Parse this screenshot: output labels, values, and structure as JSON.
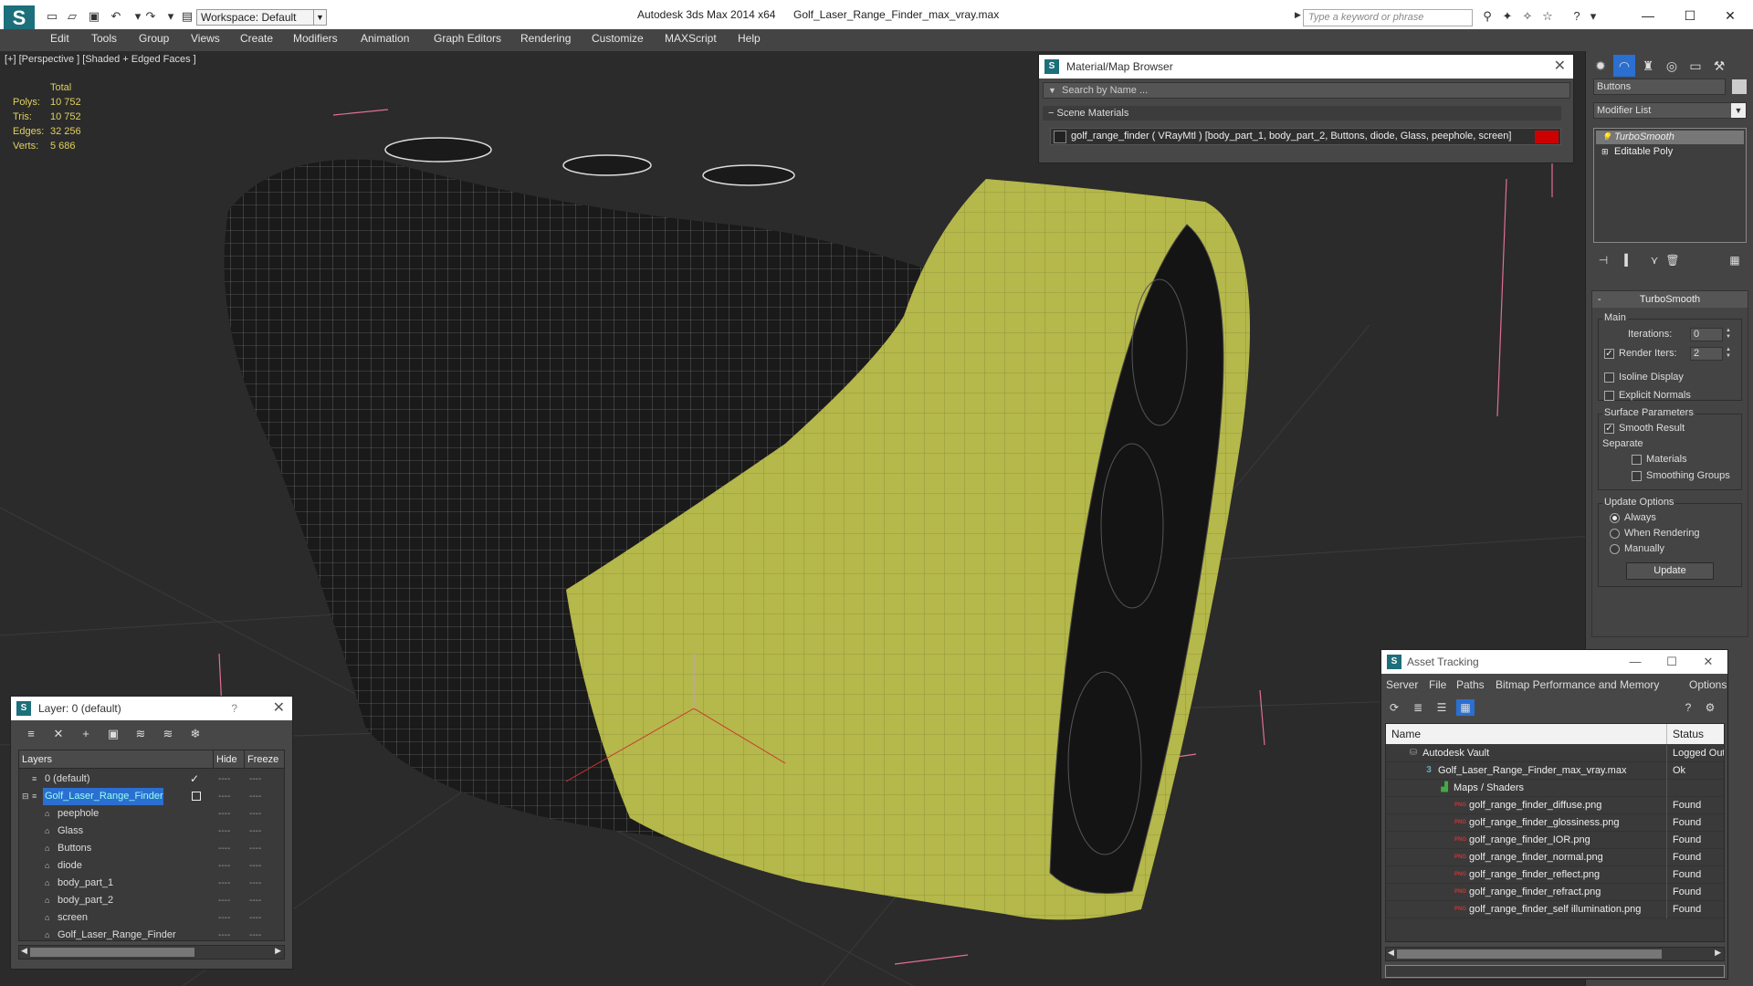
{
  "titlebar": {
    "app_title": "Autodesk 3ds Max  2014 x64",
    "file_title": "Golf_Laser_Range_Finder_max_vray.max",
    "workspace": "Workspace: Default",
    "search_placeholder": "Type a keyword or phrase"
  },
  "menu": [
    "Edit",
    "Tools",
    "Group",
    "Views",
    "Create",
    "Modifiers",
    "Animation",
    "Graph Editors",
    "Rendering",
    "Customize",
    "MAXScript",
    "Help"
  ],
  "viewport": {
    "label": "[+] [Perspective ] [Shaded + Edged Faces ]",
    "stats": {
      "total_label": "Total",
      "rows": [
        {
          "label": "Polys:",
          "value": "10 752"
        },
        {
          "label": "Tris:",
          "value": "10 752"
        },
        {
          "label": "Edges:",
          "value": "32 256"
        },
        {
          "label": "Verts:",
          "value": "5 686"
        }
      ]
    },
    "mesh_color": "#b5b84a"
  },
  "material_browser": {
    "title": "Material/Map Browser",
    "search_placeholder": "Search by Name ...",
    "section": "Scene Materials",
    "entry": "golf_range_finder  ( VRayMtl ) [body_part_1, body_part_2, Buttons, diode, Glass, peephole, screen]"
  },
  "command_panel": {
    "object_name": "Buttons",
    "modifier_list": "Modifier List",
    "stack": [
      "TurboSmooth",
      "Editable Poly"
    ],
    "turbosmooth": {
      "title": "TurboSmooth",
      "main_label": "Main",
      "iterations_label": "Iterations:",
      "iterations_value": "0",
      "render_iters_label": "Render Iters:",
      "render_iters_value": "2",
      "render_iters_checked": true,
      "isoline_label": "Isoline Display",
      "explicit_label": "Explicit Normals",
      "surface_label": "Surface Parameters",
      "smooth_label": "Smooth Result",
      "separate_label": "Separate",
      "materials_label": "Materials",
      "smoothing_groups_label": "Smoothing Groups",
      "update_options_label": "Update Options",
      "always_label": "Always",
      "when_rendering_label": "When Rendering",
      "manually_label": "Manually",
      "update_button": "Update"
    }
  },
  "layer_panel": {
    "title": "Layer: 0 (default)",
    "help": "?",
    "columns": {
      "layers": "Layers",
      "hide": "Hide",
      "freeze": "Freeze"
    },
    "rows": [
      {
        "name": "0 (default)",
        "level": 0
      },
      {
        "name": "Golf_Laser_Range_Finder",
        "level": 0
      },
      {
        "name": "peephole",
        "level": 1
      },
      {
        "name": "Glass",
        "level": 1
      },
      {
        "name": "Buttons",
        "level": 1
      },
      {
        "name": "diode",
        "level": 1
      },
      {
        "name": "body_part_1",
        "level": 1
      },
      {
        "name": "body_part_2",
        "level": 1
      },
      {
        "name": "screen",
        "level": 1
      },
      {
        "name": "Golf_Laser_Range_Finder",
        "level": 1
      }
    ]
  },
  "asset_tracking": {
    "title": "Asset Tracking",
    "menu": [
      "Server",
      "File",
      "Paths",
      "Bitmap Performance and Memory",
      "Options"
    ],
    "columns": {
      "name": "Name",
      "status": "Status"
    },
    "rows": [
      {
        "name": "Autodesk Vault",
        "status": "Logged Out",
        "level": 0,
        "icon": "vault"
      },
      {
        "name": "Golf_Laser_Range_Finder_max_vray.max",
        "status": "Ok",
        "level": 1,
        "icon": "max"
      },
      {
        "name": "Maps / Shaders",
        "status": "",
        "level": 2,
        "icon": "maps"
      },
      {
        "name": "golf_range_finder_diffuse.png",
        "status": "Found",
        "level": 3,
        "icon": "png"
      },
      {
        "name": "golf_range_finder_glossiness.png",
        "status": "Found",
        "level": 3,
        "icon": "png"
      },
      {
        "name": "golf_range_finder_IOR.png",
        "status": "Found",
        "level": 3,
        "icon": "png"
      },
      {
        "name": "golf_range_finder_normal.png",
        "status": "Found",
        "level": 3,
        "icon": "png"
      },
      {
        "name": "golf_range_finder_reflect.png",
        "status": "Found",
        "level": 3,
        "icon": "png"
      },
      {
        "name": "golf_range_finder_refract.png",
        "status": "Found",
        "level": 3,
        "icon": "png"
      },
      {
        "name": "golf_range_finder_self illumination.png",
        "status": "Found",
        "level": 3,
        "icon": "png"
      }
    ]
  }
}
